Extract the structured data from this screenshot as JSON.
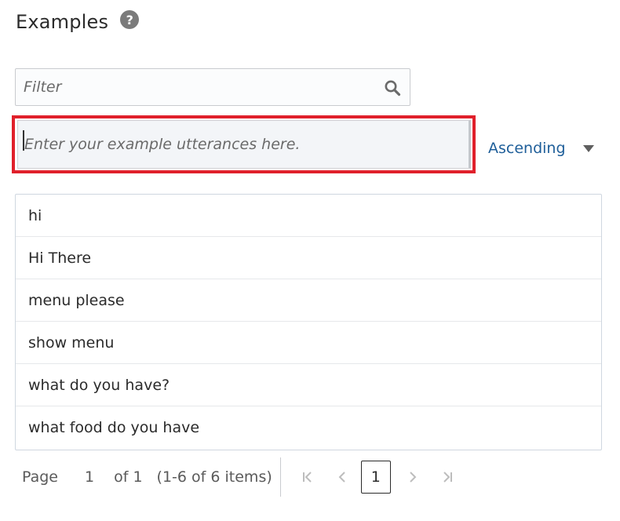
{
  "header": {
    "title": "Examples",
    "help_glyph": "?"
  },
  "filter": {
    "placeholder": "Filter",
    "value": ""
  },
  "utterance_input": {
    "placeholder": "Enter your example utterances here.",
    "value": ""
  },
  "sort": {
    "label": "Ascending"
  },
  "examples": [
    "hi",
    "Hi There",
    "menu please",
    "show menu",
    "what do you have?",
    "what food do you have"
  ],
  "pagination": {
    "page_label": "Page",
    "page_number": "1",
    "of_label": "of 1",
    "range_label": "(1-6 of 6 items)",
    "current_page": "1"
  },
  "colors": {
    "highlight": "#e0202b",
    "link": "#1e5e99",
    "icon_gray": "#7b7b7b"
  },
  "icons": [
    "help-icon",
    "search-icon",
    "chevron-down-icon",
    "first-page-icon",
    "prev-page-icon",
    "next-page-icon",
    "last-page-icon"
  ]
}
